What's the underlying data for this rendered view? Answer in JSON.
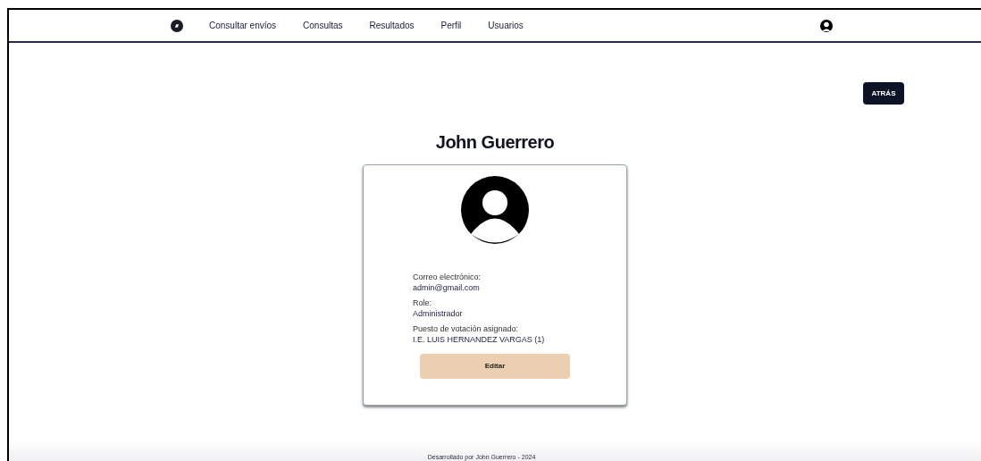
{
  "nav": {
    "links": [
      "Consultar envíos",
      "Consultas",
      "Resultados",
      "Perfil",
      "Usuarios"
    ]
  },
  "back_button": "ATRÁS",
  "profile": {
    "name": "John Guerrero",
    "fields": [
      {
        "label": "Correo electrónico:",
        "value": "admin@gmail.com"
      },
      {
        "label": "Role:",
        "value": "Administrador"
      },
      {
        "label": "Puesto de votación asignado:",
        "value": "I.E. LUIS HERNANDEZ VARGAS (1)"
      }
    ],
    "edit_button": "Editar"
  },
  "footer": "Desarrollado por John Guerrero - 2024"
}
